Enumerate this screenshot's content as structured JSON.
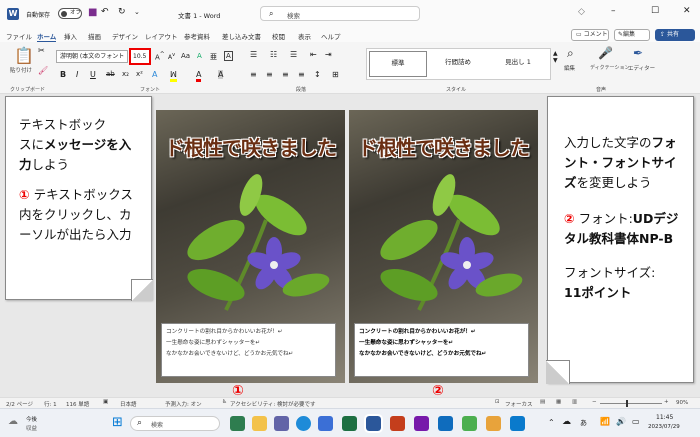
{
  "titlebar": {
    "autosave_label": "自動保存",
    "autosave_state": "オフ",
    "doc_title": "文書 1 - Word",
    "search_placeholder": "検索",
    "window_icons": [
      "minimize-icon",
      "maximize-icon",
      "close-icon"
    ]
  },
  "menu": {
    "tabs": [
      "ファイル",
      "ホーム",
      "挿入",
      "描画",
      "デザイン",
      "レイアウト",
      "参考資料",
      "差し込み文書",
      "校閲",
      "表示",
      "ヘルプ"
    ],
    "active": "ホーム",
    "comment_btn": "コメント",
    "edit_btn": "編集",
    "share_btn": "共有"
  },
  "ribbon": {
    "paste_label": "貼り付け",
    "font_name": "游明朝 (本文のフォント",
    "font_size": "10.5",
    "style_gallery": [
      "標準",
      "行間詰め",
      "見出し 1"
    ],
    "edit_label": "編集",
    "dictation_label": "ディクテーション",
    "editor_label": "エディター",
    "groups": [
      "クリップボード",
      "フォント",
      "段落",
      "スタイル",
      "音声"
    ]
  },
  "callouts": {
    "left_line1": "テキストボック",
    "left_line2": "スに",
    "left_bold": "メッセージを入力",
    "left_line3": "しよう",
    "left_step_num": "①",
    "left_step": "テキストボックス内をクリックし、カーソルが出たら入力",
    "right_text1": "入力した文字の",
    "right_bold1": "フォント・フォントサイズ",
    "right_text2": "を変更しよう",
    "right_step_num": "②",
    "right_step_a": "フォント:",
    "right_step_bold": "UDデジタル教科書体NP-B",
    "right_size_label": "フォントサイズ:",
    "right_size_bold": "11ポイント"
  },
  "pages": [
    {
      "headline": "ド根性で咲きました",
      "lines": [
        "コンクリートの割れ目からかわいいお花が！↵",
        "一生懸命な姿に思わずシャッターを↵",
        "なかなかお会いできないけど、どうかお元気でね↵"
      ],
      "marker": "①"
    },
    {
      "headline": "ド根性で咲きました",
      "lines": [
        "コンクリートの割れ目からかわいいお花が！↵",
        "一生懸命な姿に思わずシャッターを↵",
        "なかなかお会いできないけど、どうかお元気でね↵"
      ],
      "marker": "②"
    }
  ],
  "status": {
    "page": "2/2 ページ",
    "line": "行: 1",
    "words": "116 単語",
    "lang": "日本語",
    "predict": "予測入力: オン",
    "access": "アクセシビリティ: 検討が必要です",
    "focus": "フォーカス",
    "zoom": "90%"
  },
  "taskbar": {
    "weather_temp": "今後",
    "weather_sub": "収益",
    "search": "検索",
    "time": "11:45",
    "date": "2023/07/29"
  }
}
